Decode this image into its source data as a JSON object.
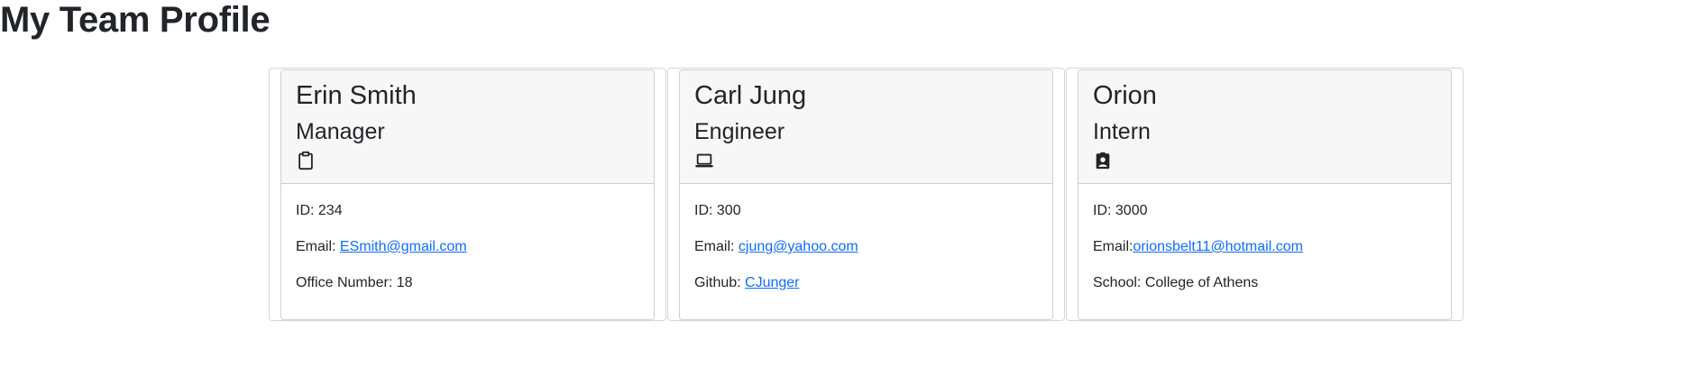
{
  "page": {
    "title": "My Team Profile"
  },
  "theme": {
    "text_color": "#212529",
    "link_color": "#0d6efd",
    "header_bg": "#f7f7f7",
    "border_color": "#cfcfcf"
  },
  "team": [
    {
      "name": "Erin Smith",
      "role": "Manager",
      "icon": "clipboard-icon",
      "id_text": "ID: 234",
      "email_label": "Email: ",
      "email": "ESmith@gmail.com",
      "extra_label": "Office Number: 18",
      "extra_link": ""
    },
    {
      "name": "Carl Jung",
      "role": "Engineer",
      "icon": "laptop-icon",
      "id_text": "ID: 300",
      "email_label": "Email: ",
      "email": "cjung@yahoo.com",
      "extra_label": "Github: ",
      "extra_link": "CJunger"
    },
    {
      "name": "Orion",
      "role": "Intern",
      "icon": "student-id-icon",
      "id_text": "ID: 3000",
      "email_label": "Email:",
      "email": "orionsbelt11@hotmail.com",
      "extra_label": "School: College of Athens",
      "extra_link": ""
    }
  ]
}
